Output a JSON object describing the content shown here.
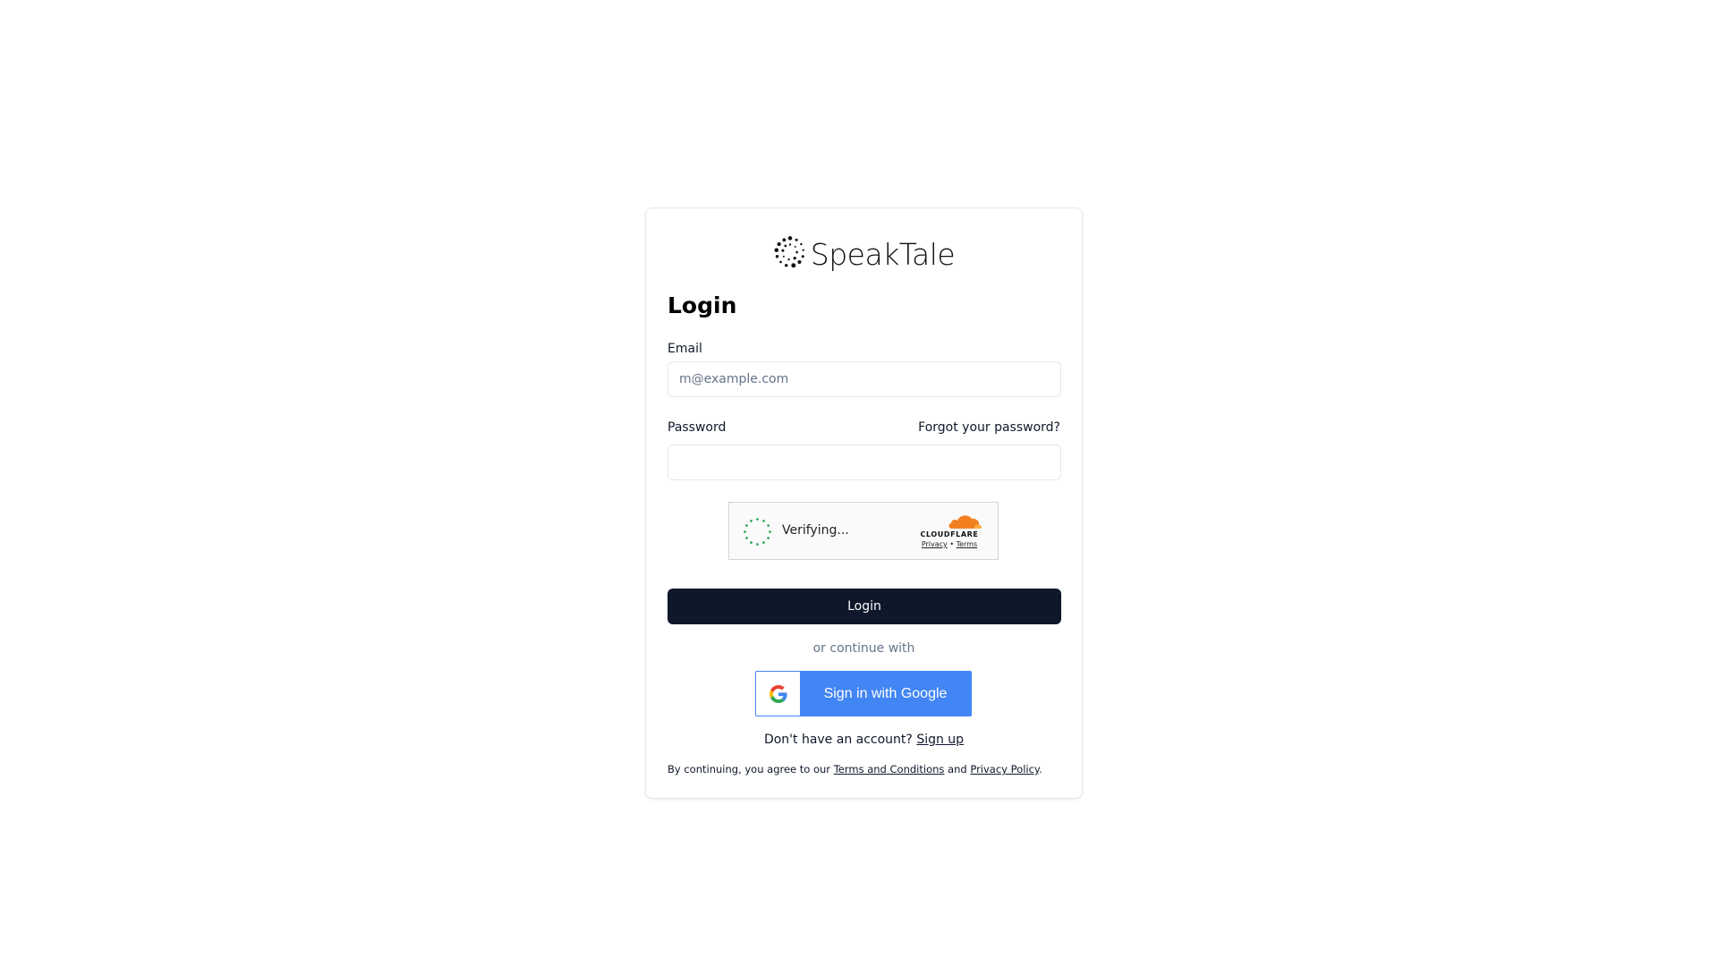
{
  "brand": {
    "logo_icon": "dotted-circle-logo-icon",
    "name": "SpeakTale"
  },
  "form": {
    "title": "Login",
    "email": {
      "label": "Email",
      "placeholder": "m@example.com",
      "value": ""
    },
    "password": {
      "label": "Password",
      "value": "",
      "forgot_link": "Forgot your password?"
    },
    "captcha": {
      "status": "Verifying...",
      "provider": "CLOUDFLARE",
      "privacy_link": "Privacy",
      "separator": "•",
      "terms_link": "Terms"
    },
    "submit_label": "Login",
    "divider_text": "or continue with",
    "google_button": {
      "label": "Sign in with Google",
      "color": "#4285f4"
    },
    "signup": {
      "prompt": "Don't have an account?",
      "link": "Sign up"
    },
    "legal": {
      "prefix": "By continuing, you agree to our",
      "terms_link": "Terms and Conditions",
      "conjunction": "and",
      "privacy_link": "Privacy Policy",
      "suffix": "."
    }
  },
  "colors": {
    "primary_button": "#0f172a",
    "captcha_spinner": "#1a9e4a",
    "cloudflare_orange": "#f38020"
  }
}
